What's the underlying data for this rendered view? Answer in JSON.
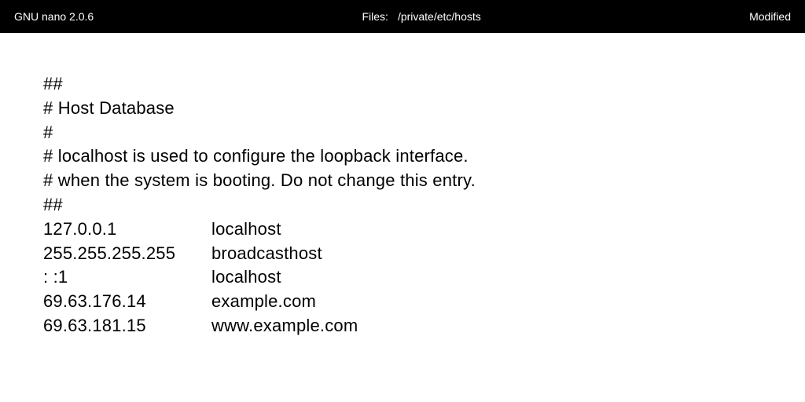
{
  "header": {
    "app": "GNU nano 2.0.6",
    "file_label": "Files:",
    "file_path": "/private/etc/hosts",
    "status": "Modified"
  },
  "content": {
    "comments": [
      "##",
      "# Host Database",
      "#",
      "# localhost is used to configure the loopback interface.",
      "# when the system is booting. Do not change this entry.",
      "##"
    ],
    "entries": [
      {
        "ip": "127.0.0.1",
        "host": "localhost"
      },
      {
        "ip": "255.255.255.255",
        "host": "broadcasthost"
      },
      {
        "ip": ": :1",
        "host": "localhost"
      },
      {
        "ip": "69.63.176.14",
        "host": "example.com"
      },
      {
        "ip": "69.63.181.15",
        "host": "www.example.com"
      }
    ]
  }
}
